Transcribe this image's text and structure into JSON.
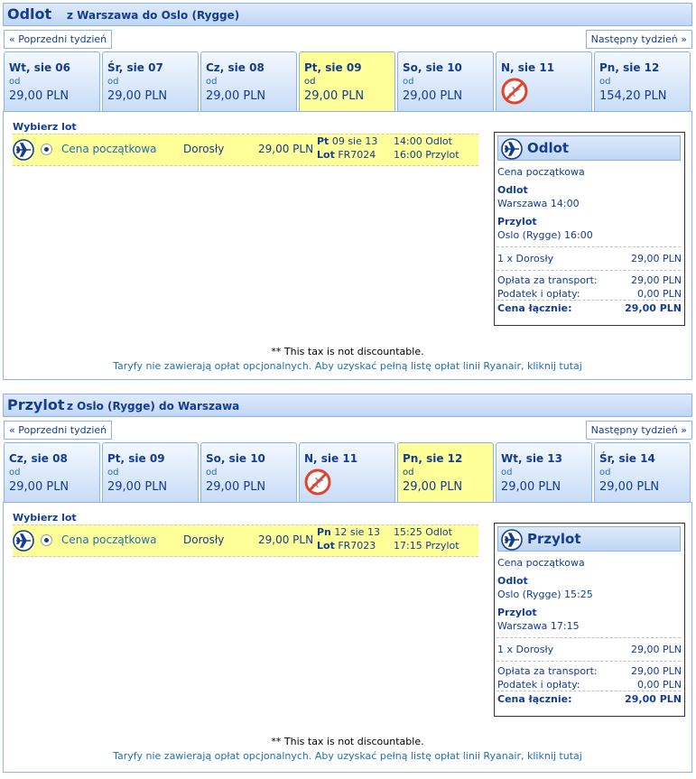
{
  "outbound": {
    "title": "Odlot",
    "subtitle": "z Warszawa do Oslo (Rygge)",
    "prev_week": "« Poprzedni tydzień",
    "next_week": "Następny tydzień »",
    "days": [
      {
        "label": "Wt, sie 06",
        "od": "od",
        "price": "29,00 PLN",
        "selected": false,
        "available": true
      },
      {
        "label": "Śr, sie 07",
        "od": "od",
        "price": "29,00 PLN",
        "selected": false,
        "available": true
      },
      {
        "label": "Cz, sie 08",
        "od": "od",
        "price": "29,00 PLN",
        "selected": false,
        "available": true
      },
      {
        "label": "Pt, sie 09",
        "od": "od",
        "price": "29,00 PLN",
        "selected": true,
        "available": true
      },
      {
        "label": "So, sie 10",
        "od": "od",
        "price": "29,00 PLN",
        "selected": false,
        "available": true
      },
      {
        "label": "N, sie 11",
        "od": "",
        "price": "",
        "selected": false,
        "available": false
      },
      {
        "label": "Pn, sie 12",
        "od": "od",
        "price": "154,20 PLN",
        "selected": false,
        "available": true
      }
    ],
    "choose_label": "Wybierz lot",
    "flight": {
      "fare": "Cena początkowa",
      "passenger": "Dorosły",
      "price": "29,00 PLN",
      "day_bold": "Pt",
      "date": "09 sie 13",
      "lot_bold": "Lot",
      "flight_no": "FR7024",
      "dep_time": "14:00",
      "dep_label": "Odlot",
      "arr_time": "16:00",
      "arr_label": "Przylot"
    },
    "summary": {
      "title": "Odlot",
      "fare": "Cena początkowa",
      "dep_heading": "Odlot",
      "dep_text": "Warszawa 14:00",
      "arr_heading": "Przylot",
      "arr_text": "Oslo (Rygge) 16:00",
      "pax_label": "1 x Dorosły",
      "pax_value": "29,00 PLN",
      "fee_label": "Opłata za transport:",
      "fee_value": "29,00 PLN",
      "tax_label": "Podatek i opłaty:",
      "tax_value": "0,00 PLN",
      "total_label": "Cena łącznie:",
      "total_value": "29,00 PLN"
    },
    "footnote": "** This tax is not discountable.",
    "note": "Taryfy nie zawierają opłat opcjonalnych. Aby uzyskać pełną listę opłat linii Ryanair, kliknij tutaj"
  },
  "inbound": {
    "title": "Przylot",
    "subtitle": "z Oslo (Rygge) do Warszawa",
    "prev_week": "« Poprzedni tydzień",
    "next_week": "Następny tydzień »",
    "days": [
      {
        "label": "Cz, sie 08",
        "od": "od",
        "price": "29,00 PLN",
        "selected": false,
        "available": true
      },
      {
        "label": "Pt, sie 09",
        "od": "od",
        "price": "29,00 PLN",
        "selected": false,
        "available": true
      },
      {
        "label": "So, sie 10",
        "od": "od",
        "price": "29,00 PLN",
        "selected": false,
        "available": true
      },
      {
        "label": "N, sie 11",
        "od": "",
        "price": "",
        "selected": false,
        "available": false
      },
      {
        "label": "Pn, sie 12",
        "od": "od",
        "price": "29,00 PLN",
        "selected": true,
        "available": true
      },
      {
        "label": "Wt, sie 13",
        "od": "od",
        "price": "29,00 PLN",
        "selected": false,
        "available": true
      },
      {
        "label": "Śr, sie 14",
        "od": "od",
        "price": "29,00 PLN",
        "selected": false,
        "available": true
      }
    ],
    "choose_label": "Wybierz lot",
    "flight": {
      "fare": "Cena początkowa",
      "passenger": "Dorosły",
      "price": "29,00 PLN",
      "day_bold": "Pn",
      "date": "12 sie 13",
      "lot_bold": "Lot",
      "flight_no": "FR7023",
      "dep_time": "15:25",
      "dep_label": "Odlot",
      "arr_time": "17:15",
      "arr_label": "Przylot"
    },
    "summary": {
      "title": "Przylot",
      "fare": "Cena początkowa",
      "dep_heading": "Odlot",
      "dep_text": "Oslo (Rygge) 15:25",
      "arr_heading": "Przylot",
      "arr_text": "Warszawa 17:15",
      "pax_label": "1 x Dorosły",
      "pax_value": "29,00 PLN",
      "fee_label": "Opłata za transport:",
      "fee_value": "29,00 PLN",
      "tax_label": "Podatek i opłaty:",
      "tax_value": "0,00 PLN",
      "total_label": "Cena łącznie:",
      "total_value": "29,00 PLN"
    },
    "footnote": "** This tax is not discountable.",
    "note": "Taryfy nie zawierają opłat opcjonalnych. Aby uzyskać pełną listę opłat linii Ryanair, kliknij tutaj"
  },
  "colors": {
    "header_text": "#133d8d",
    "link": "#1f6fb8",
    "selected_bg": "#ffff99",
    "border": "#8db2e3"
  },
  "icons": {
    "airplane": "airplane-icon",
    "no_flight": "no-flight-icon"
  }
}
